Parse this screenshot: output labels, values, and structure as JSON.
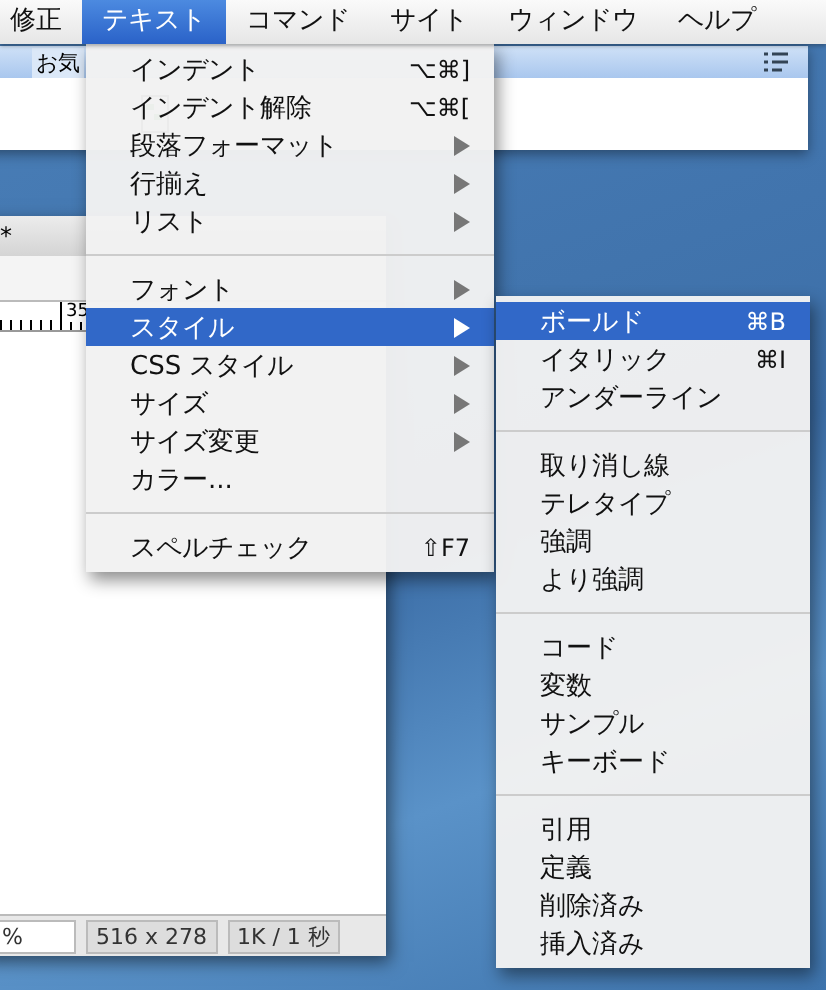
{
  "menu_bar": [
    {
      "label": "修正",
      "selected": false
    },
    {
      "label": "テキスト",
      "selected": true
    },
    {
      "label": "コマンド",
      "selected": false
    },
    {
      "label": "サイト",
      "selected": false
    },
    {
      "label": "ウィンドウ",
      "selected": false
    },
    {
      "label": "ヘルプ",
      "selected": false
    }
  ],
  "toolbar_window": {
    "tab_label": "お気"
  },
  "document_window": {
    "title": "*",
    "ruler_label": "35",
    "status_fields": [
      "%",
      "516 x 278",
      "1K / 1 秒"
    ]
  },
  "menu": {
    "sections": [
      [
        {
          "label": "インデント",
          "shortcut": "⌥⌘]",
          "has_submenu": false,
          "selected": false
        },
        {
          "label": "インデント解除",
          "shortcut": "⌥⌘[",
          "has_submenu": false,
          "selected": false
        },
        {
          "label": "段落フォーマット",
          "has_submenu": true,
          "selected": false
        },
        {
          "label": "行揃え",
          "has_submenu": true,
          "selected": false
        },
        {
          "label": "リスト",
          "has_submenu": true,
          "selected": false
        }
      ],
      [
        {
          "label": "フォント",
          "has_submenu": true,
          "selected": false
        },
        {
          "label": "スタイル",
          "has_submenu": true,
          "selected": true
        },
        {
          "label": "CSS スタイル",
          "has_submenu": true,
          "selected": false
        },
        {
          "label": "サイズ",
          "has_submenu": true,
          "selected": false
        },
        {
          "label": "サイズ変更",
          "has_submenu": true,
          "selected": false
        },
        {
          "label": "カラー...",
          "has_submenu": false,
          "selected": false
        }
      ],
      [
        {
          "label": "スペルチェック",
          "shortcut": "⇧F7",
          "has_submenu": false,
          "selected": false
        }
      ]
    ]
  },
  "submenu": {
    "sections": [
      [
        {
          "label": "ボールド",
          "shortcut": "⌘B",
          "selected": true
        },
        {
          "label": "イタリック",
          "shortcut": "⌘I",
          "selected": false
        },
        {
          "label": "アンダーライン",
          "selected": false
        }
      ],
      [
        {
          "label": "取り消し線",
          "selected": false
        },
        {
          "label": "テレタイプ",
          "selected": false
        },
        {
          "label": "強調",
          "selected": false
        },
        {
          "label": "より強調",
          "selected": false
        }
      ],
      [
        {
          "label": "コード",
          "selected": false
        },
        {
          "label": "変数",
          "selected": false
        },
        {
          "label": "サンプル",
          "selected": false
        },
        {
          "label": "キーボード",
          "selected": false
        }
      ],
      [
        {
          "label": "引用",
          "selected": false
        },
        {
          "label": "定義",
          "selected": false
        },
        {
          "label": "削除済み",
          "selected": false
        },
        {
          "label": "挿入済み",
          "selected": false
        }
      ]
    ]
  }
}
